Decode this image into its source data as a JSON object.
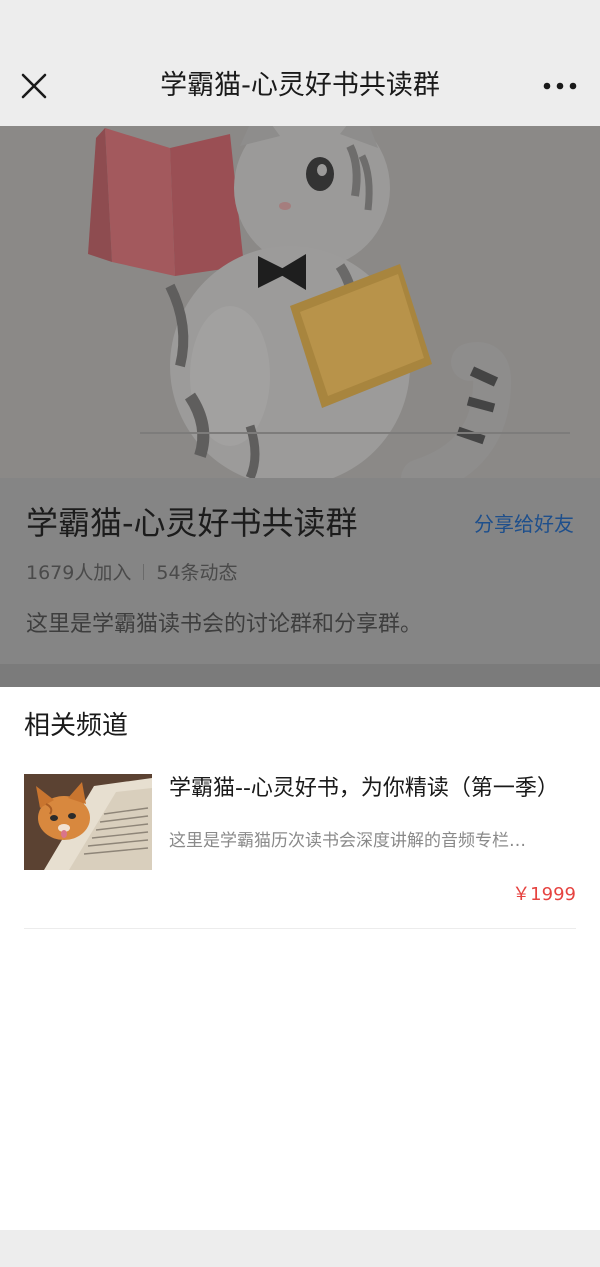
{
  "navbar": {
    "title": "学霸猫-心灵好书共读群",
    "close_icon": "close-icon",
    "more_icon": "more-dots-icon"
  },
  "group": {
    "title": "学霸猫-心灵好书共读群",
    "share_label": "分享给好友",
    "members": "1679人加入",
    "posts": "54条动态",
    "description": "这里是学霸猫读书会的讨论群和分享群。"
  },
  "related": {
    "section_title": "相关频道",
    "channels": [
      {
        "title": "学霸猫--心灵好书，为你精读（第一季）",
        "description": "这里是学霸猫历次读书会深度讲解的音频专栏…",
        "price": "￥1999"
      }
    ]
  },
  "colors": {
    "accent_link": "#1e4f8c",
    "price": "#e64340"
  }
}
